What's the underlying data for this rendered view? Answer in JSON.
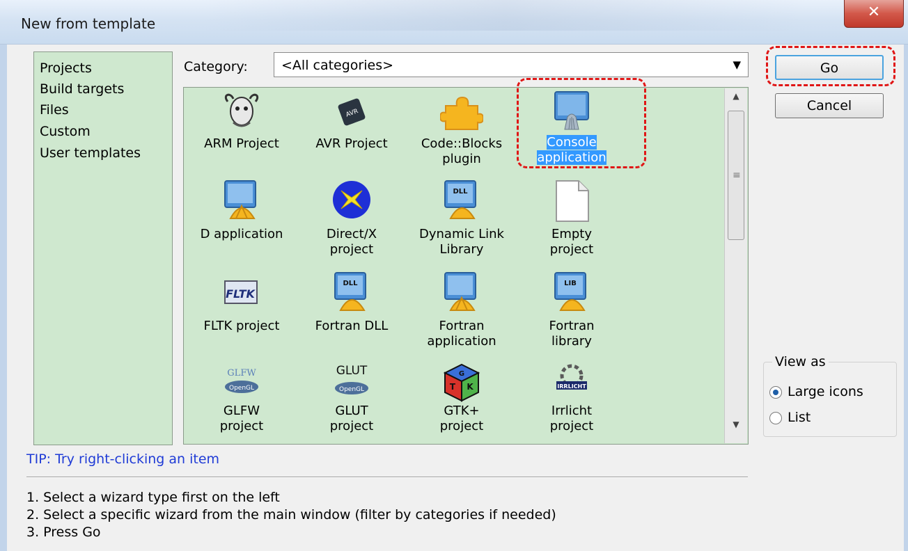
{
  "window": {
    "title": "New from template",
    "close_glyph": "✕"
  },
  "sidebar": {
    "items": [
      {
        "label": "Projects"
      },
      {
        "label": "Build targets"
      },
      {
        "label": "Files"
      },
      {
        "label": "Custom"
      },
      {
        "label": "User templates"
      }
    ]
  },
  "category": {
    "label": "Category:",
    "selected": "<All categories>"
  },
  "templates": [
    {
      "label1": "ARM Project",
      "label2": "",
      "icon": "gnu-icon"
    },
    {
      "label1": "AVR Project",
      "label2": "",
      "icon": "avr-chip-icon"
    },
    {
      "label1": "Code::Blocks",
      "label2": "plugin",
      "icon": "puzzle-icon"
    },
    {
      "label1": "Console",
      "label2": "application",
      "icon": "console-app-icon",
      "selected": true
    },
    {
      "label1": "D application",
      "label2": "",
      "icon": "app-icon"
    },
    {
      "label1": "Direct/X",
      "label2": "project",
      "icon": "directx-icon"
    },
    {
      "label1": "Dynamic Link",
      "label2": "Library",
      "icon": "dll-icon",
      "badge": "DLL"
    },
    {
      "label1": "Empty",
      "label2": "project",
      "icon": "empty-file-icon"
    },
    {
      "label1": "FLTK project",
      "label2": "",
      "icon": "fltk-icon",
      "badge": "FLTK"
    },
    {
      "label1": "Fortran DLL",
      "label2": "",
      "icon": "dll-icon",
      "badge": "DLL"
    },
    {
      "label1": "Fortran",
      "label2": "application",
      "icon": "app-icon"
    },
    {
      "label1": "Fortran",
      "label2": "library",
      "icon": "lib-icon",
      "badge": "LIB"
    },
    {
      "label1": "GLFW",
      "label2": "project",
      "icon": "glfw-icon",
      "badge": "GLFW",
      "badge2": "OpenGL"
    },
    {
      "label1": "GLUT",
      "label2": "project",
      "icon": "glut-icon",
      "badge": "GLUT",
      "badge2": "OpenGL"
    },
    {
      "label1": "GTK+",
      "label2": "project",
      "icon": "gtk-cube-icon"
    },
    {
      "label1": "Irrlicht",
      "label2": "project",
      "icon": "irrlicht-icon",
      "badge": "IRRLICHT"
    }
  ],
  "buttons": {
    "go": "Go",
    "cancel": "Cancel"
  },
  "view_as": {
    "legend": "View as",
    "options": [
      {
        "label": "Large icons",
        "checked": true
      },
      {
        "label": "List",
        "checked": false
      }
    ]
  },
  "tip": "TIP: Try right-clicking an item",
  "steps": [
    "1. Select a wizard type first on the left",
    "2. Select a specific wizard from the main window (filter by categories if needed)",
    "3. Press Go"
  ]
}
